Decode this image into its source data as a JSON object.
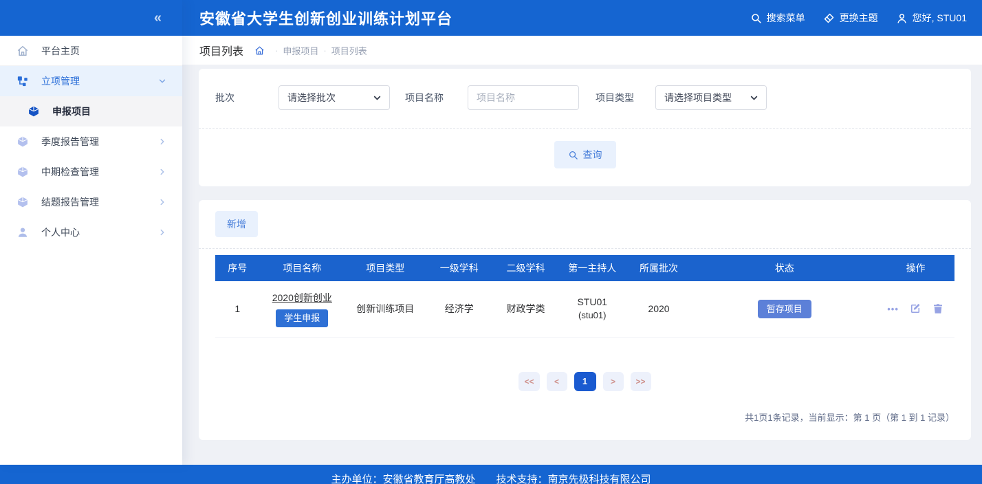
{
  "colors": {
    "primary_blue": "#1565d1",
    "table_header_blue": "#1b63cd",
    "apply_badge_blue": "#2e70d5",
    "status_badge_blue": "#5c80d8",
    "action_icon_periwinkle": "#97a3e4",
    "pagination_arrow_salmon": "#cf928d",
    "pagination_active_blue": "#1a5ad0",
    "light_button_bg": "#e9f1fd",
    "light_button_text": "#4a80da",
    "page_background": "#eff1f6"
  },
  "icons": {
    "collapse": "«",
    "ellipsis": "•••"
  },
  "topbar": {
    "title": "安徽省大学生创新创业训练计划平台",
    "search_menu": "搜索菜单",
    "change_theme": "更换主题",
    "greeting": "您好, STU01"
  },
  "sidebar": {
    "items": [
      {
        "label": "平台主页",
        "icon": "home-icon"
      },
      {
        "label": "立项管理",
        "icon": "sitemap-icon",
        "state": "expanded"
      },
      {
        "label": "申报项目",
        "icon": "cube-icon",
        "state": "selected"
      },
      {
        "label": "季度报告管理",
        "icon": "cube-icon",
        "state": "collapsed"
      },
      {
        "label": "中期检查管理",
        "icon": "cube-icon",
        "state": "collapsed"
      },
      {
        "label": "结题报告管理",
        "icon": "cube-icon",
        "state": "collapsed"
      },
      {
        "label": "个人中心",
        "icon": "user-icon",
        "state": "collapsed"
      }
    ]
  },
  "breadcrumb": {
    "title": "项目列表",
    "separator": "·",
    "crumbs": [
      "申报项目",
      "项目列表"
    ]
  },
  "filters": {
    "batch": {
      "label": "批次",
      "value": "请选择批次"
    },
    "project_name": {
      "label": "项目名称",
      "placeholder": "项目名称"
    },
    "project_type": {
      "label": "项目类型",
      "value": "请选择项目类型"
    },
    "query_button": "查询"
  },
  "toolbar": {
    "add_button": "新增"
  },
  "table": {
    "headers": [
      "序号",
      "项目名称",
      "项目类型",
      "一级学科",
      "二级学科",
      "第一主持人",
      "所属批次",
      "状态",
      "操作"
    ],
    "rows": [
      {
        "seq": "1",
        "project_name": "2020创新创业",
        "project_badge": "学生申报",
        "project_type": "创新训练项目",
        "primary_discipline": "经济学",
        "secondary_discipline": "财政学类",
        "leader_name": "STU01",
        "leader_account": "(stu01)",
        "batch": "2020",
        "status": "暂存项目"
      }
    ]
  },
  "pagination": {
    "first": "<<",
    "prev": "<",
    "current": "1",
    "next": ">",
    "last": ">>",
    "summary": "共1页1条记录，当前显示：第 1 页（第 1 到 1 记录）"
  },
  "footer": {
    "text": "主办单位：安徽省教育厅高教处　　技术支持：南京先极科技有限公司"
  }
}
